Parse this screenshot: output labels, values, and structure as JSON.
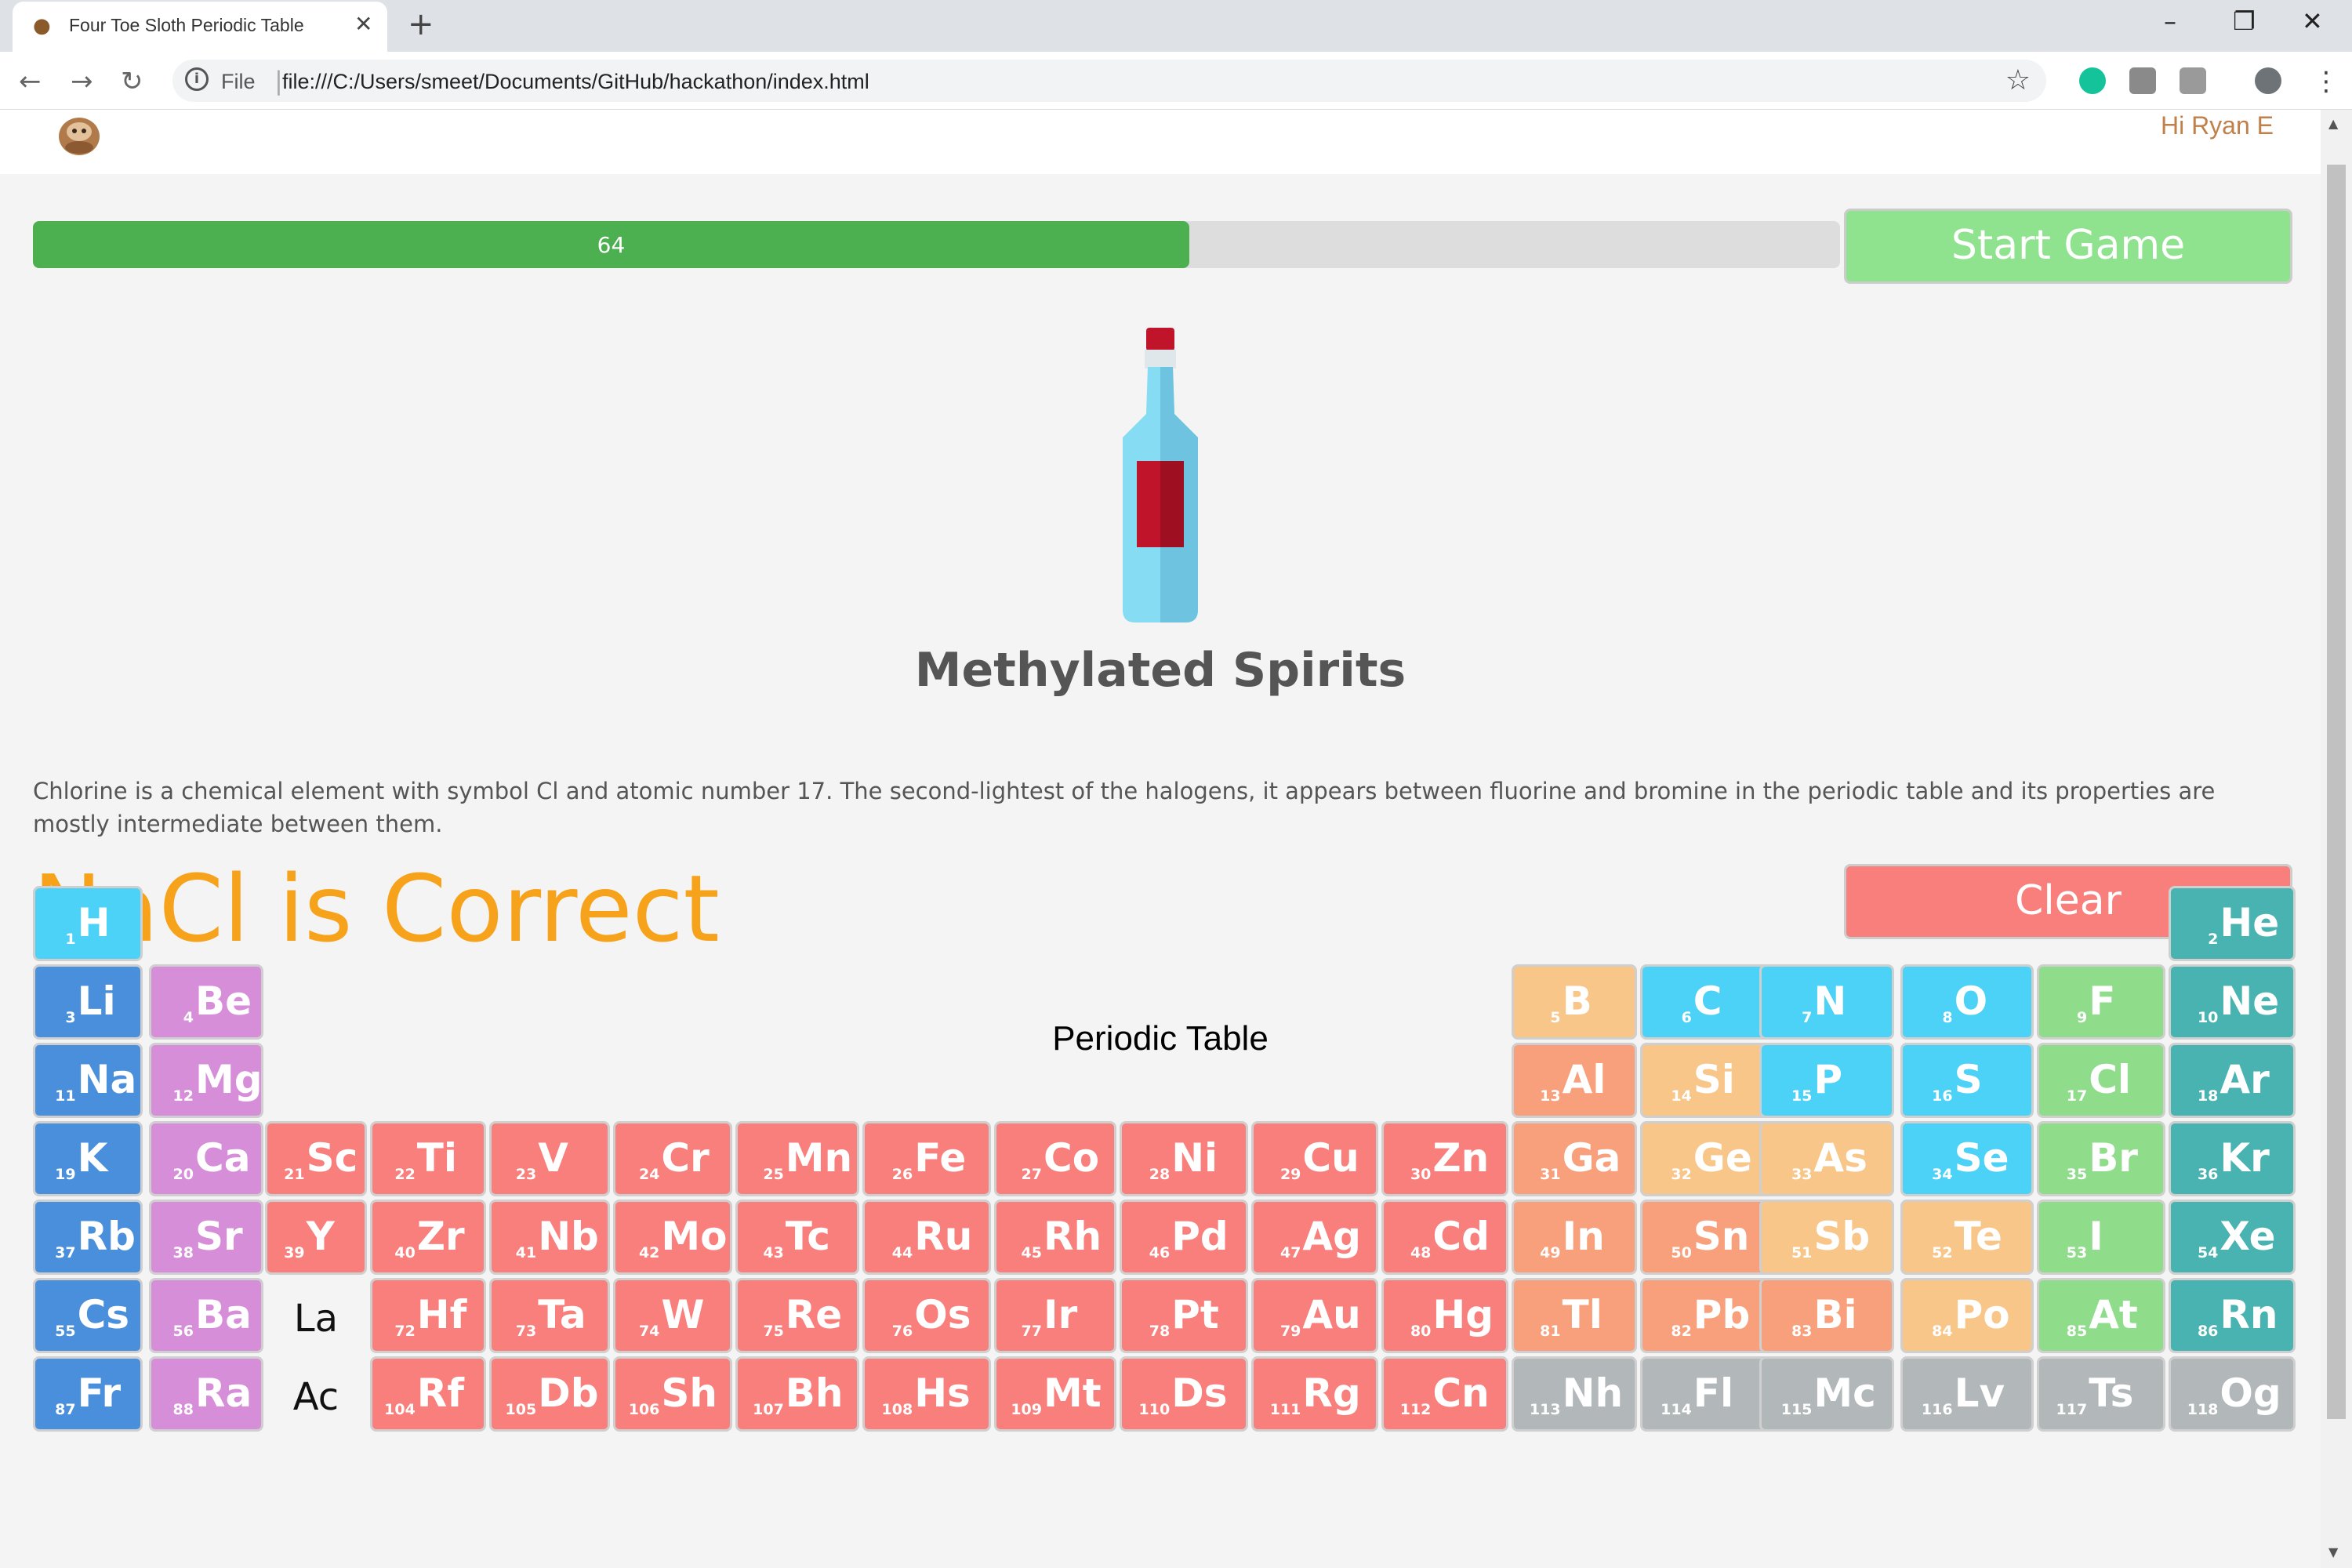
{
  "browser": {
    "tab_title": "Four Toe Sloth Periodic Table",
    "omnibox_file": "File",
    "url": "file:///C:/Users/smeet/Documents/GitHub/hackathon/index.html"
  },
  "header": {
    "greeting": "Hi Ryan E"
  },
  "progress": {
    "value": 64,
    "label": "64",
    "max": 100
  },
  "buttons": {
    "start": "Start Game",
    "clear": "Clear"
  },
  "item": {
    "name": "Methylated Spirits"
  },
  "description": "Chlorine is a chemical element with symbol Cl and atomic number 17. The second-lightest of the halogens, it appears between fluorine and bromine in the periodic table and its properties are mostly intermediate between them.",
  "result_text": "NaCl is Correct",
  "periodic_table": {
    "title": "Periodic Table",
    "placeholders": [
      "La",
      "Ac"
    ],
    "colors": {
      "nonmetal": "#4dd2f7",
      "alkali": "#4a8fdb",
      "alkaline": "#d68ed9",
      "transition": "#f87f7c",
      "post": "#f7a07b",
      "metalloid": "#f9c68a",
      "halogen": "#8fdd8b",
      "noble": "#48b3b0",
      "unknown": "#b2b7ba"
    },
    "elements": [
      {
        "n": 1,
        "s": "H",
        "t": "nonmetal"
      },
      {
        "n": 2,
        "s": "He",
        "t": "noble"
      },
      {
        "n": 3,
        "s": "Li",
        "t": "alkali"
      },
      {
        "n": 4,
        "s": "Be",
        "t": "alkaline"
      },
      {
        "n": 5,
        "s": "B",
        "t": "metalloid"
      },
      {
        "n": 6,
        "s": "C",
        "t": "nonmetal"
      },
      {
        "n": 7,
        "s": "N",
        "t": "nonmetal"
      },
      {
        "n": 8,
        "s": "O",
        "t": "nonmetal"
      },
      {
        "n": 9,
        "s": "F",
        "t": "halogen"
      },
      {
        "n": 10,
        "s": "Ne",
        "t": "noble"
      },
      {
        "n": 11,
        "s": "Na",
        "t": "alkali"
      },
      {
        "n": 12,
        "s": "Mg",
        "t": "alkaline"
      },
      {
        "n": 13,
        "s": "Al",
        "t": "post"
      },
      {
        "n": 14,
        "s": "Si",
        "t": "metalloid"
      },
      {
        "n": 15,
        "s": "P",
        "t": "nonmetal"
      },
      {
        "n": 16,
        "s": "S",
        "t": "nonmetal"
      },
      {
        "n": 17,
        "s": "Cl",
        "t": "halogen"
      },
      {
        "n": 18,
        "s": "Ar",
        "t": "noble"
      },
      {
        "n": 19,
        "s": "K",
        "t": "alkali"
      },
      {
        "n": 20,
        "s": "Ca",
        "t": "alkaline"
      },
      {
        "n": 21,
        "s": "Sc",
        "t": "transition"
      },
      {
        "n": 22,
        "s": "Ti",
        "t": "transition"
      },
      {
        "n": 23,
        "s": "V",
        "t": "transition"
      },
      {
        "n": 24,
        "s": "Cr",
        "t": "transition"
      },
      {
        "n": 25,
        "s": "Mn",
        "t": "transition"
      },
      {
        "n": 26,
        "s": "Fe",
        "t": "transition"
      },
      {
        "n": 27,
        "s": "Co",
        "t": "transition"
      },
      {
        "n": 28,
        "s": "Ni",
        "t": "transition"
      },
      {
        "n": 29,
        "s": "Cu",
        "t": "transition"
      },
      {
        "n": 30,
        "s": "Zn",
        "t": "transition"
      },
      {
        "n": 31,
        "s": "Ga",
        "t": "post"
      },
      {
        "n": 32,
        "s": "Ge",
        "t": "metalloid"
      },
      {
        "n": 33,
        "s": "As",
        "t": "metalloid"
      },
      {
        "n": 34,
        "s": "Se",
        "t": "nonmetal"
      },
      {
        "n": 35,
        "s": "Br",
        "t": "halogen"
      },
      {
        "n": 36,
        "s": "Kr",
        "t": "noble"
      },
      {
        "n": 37,
        "s": "Rb",
        "t": "alkali"
      },
      {
        "n": 38,
        "s": "Sr",
        "t": "alkaline"
      },
      {
        "n": 39,
        "s": "Y",
        "t": "transition"
      },
      {
        "n": 40,
        "s": "Zr",
        "t": "transition"
      },
      {
        "n": 41,
        "s": "Nb",
        "t": "transition"
      },
      {
        "n": 42,
        "s": "Mo",
        "t": "transition"
      },
      {
        "n": 43,
        "s": "Tc",
        "t": "transition"
      },
      {
        "n": 44,
        "s": "Ru",
        "t": "transition"
      },
      {
        "n": 45,
        "s": "Rh",
        "t": "transition"
      },
      {
        "n": 46,
        "s": "Pd",
        "t": "transition"
      },
      {
        "n": 47,
        "s": "Ag",
        "t": "transition"
      },
      {
        "n": 48,
        "s": "Cd",
        "t": "transition"
      },
      {
        "n": 49,
        "s": "In",
        "t": "post"
      },
      {
        "n": 50,
        "s": "Sn",
        "t": "post"
      },
      {
        "n": 51,
        "s": "Sb",
        "t": "metalloid"
      },
      {
        "n": 52,
        "s": "Te",
        "t": "metalloid"
      },
      {
        "n": 53,
        "s": "I",
        "t": "halogen"
      },
      {
        "n": 54,
        "s": "Xe",
        "t": "noble"
      },
      {
        "n": 55,
        "s": "Cs",
        "t": "alkali"
      },
      {
        "n": 56,
        "s": "Ba",
        "t": "alkaline"
      },
      {
        "n": 72,
        "s": "Hf",
        "t": "transition"
      },
      {
        "n": 73,
        "s": "Ta",
        "t": "transition"
      },
      {
        "n": 74,
        "s": "W",
        "t": "transition"
      },
      {
        "n": 75,
        "s": "Re",
        "t": "transition"
      },
      {
        "n": 76,
        "s": "Os",
        "t": "transition"
      },
      {
        "n": 77,
        "s": "Ir",
        "t": "transition"
      },
      {
        "n": 78,
        "s": "Pt",
        "t": "transition"
      },
      {
        "n": 79,
        "s": "Au",
        "t": "transition"
      },
      {
        "n": 80,
        "s": "Hg",
        "t": "transition"
      },
      {
        "n": 81,
        "s": "Tl",
        "t": "post"
      },
      {
        "n": 82,
        "s": "Pb",
        "t": "post"
      },
      {
        "n": 83,
        "s": "Bi",
        "t": "post"
      },
      {
        "n": 84,
        "s": "Po",
        "t": "metalloid"
      },
      {
        "n": 85,
        "s": "At",
        "t": "halogen"
      },
      {
        "n": 86,
        "s": "Rn",
        "t": "noble"
      },
      {
        "n": 87,
        "s": "Fr",
        "t": "alkali"
      },
      {
        "n": 88,
        "s": "Ra",
        "t": "alkaline"
      },
      {
        "n": 104,
        "s": "Rf",
        "t": "transition"
      },
      {
        "n": 105,
        "s": "Db",
        "t": "transition"
      },
      {
        "n": 106,
        "s": "Sh",
        "t": "transition"
      },
      {
        "n": 107,
        "s": "Bh",
        "t": "transition"
      },
      {
        "n": 108,
        "s": "Hs",
        "t": "transition"
      },
      {
        "n": 109,
        "s": "Mt",
        "t": "transition"
      },
      {
        "n": 110,
        "s": "Ds",
        "t": "transition"
      },
      {
        "n": 111,
        "s": "Rg",
        "t": "transition"
      },
      {
        "n": 112,
        "s": "Cn",
        "t": "transition"
      },
      {
        "n": 113,
        "s": "Nh",
        "t": "unknown"
      },
      {
        "n": 114,
        "s": "Fl",
        "t": "unknown"
      },
      {
        "n": 115,
        "s": "Mc",
        "t": "unknown"
      },
      {
        "n": 116,
        "s": "Lv",
        "t": "unknown"
      },
      {
        "n": 117,
        "s": "Ts",
        "t": "unknown"
      },
      {
        "n": 118,
        "s": "Og",
        "t": "unknown"
      }
    ]
  }
}
